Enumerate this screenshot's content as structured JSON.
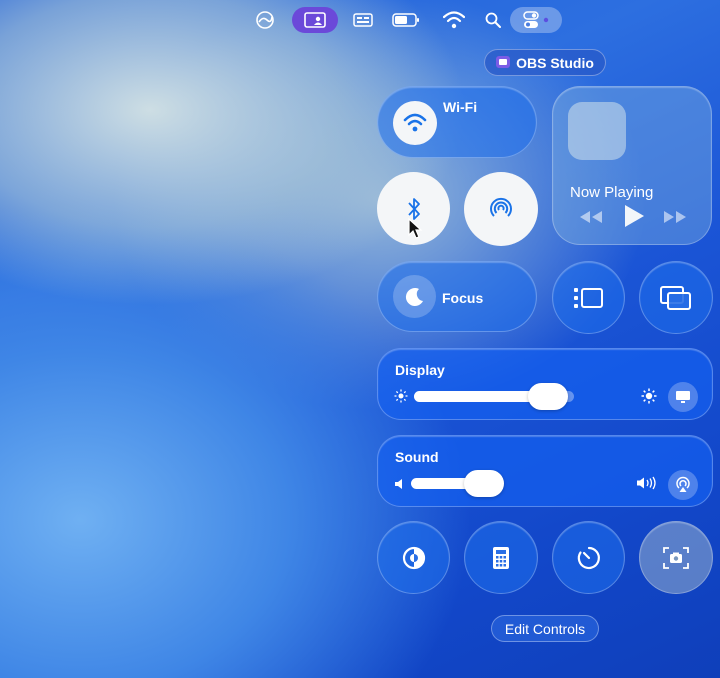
{
  "menubar": {
    "icons": [
      "stage-manager-icon",
      "screen-share-icon",
      "keyboard-layout-icon",
      "battery-icon",
      "wifi-icon",
      "spotlight-icon",
      "control-center-icon"
    ]
  },
  "obs": {
    "label": "OBS Studio"
  },
  "wifi": {
    "label": "Wi-Fi"
  },
  "now_playing": {
    "label": "Now Playing"
  },
  "focus": {
    "label": "Focus"
  },
  "display": {
    "label": "Display",
    "brightness": 0.84
  },
  "sound": {
    "label": "Sound",
    "volume": 0.32
  },
  "edit_controls": {
    "label": "Edit Controls"
  },
  "colors": {
    "accent": "#1a73e8",
    "tile": "#2f7df0",
    "white": "#f4f6f8"
  }
}
